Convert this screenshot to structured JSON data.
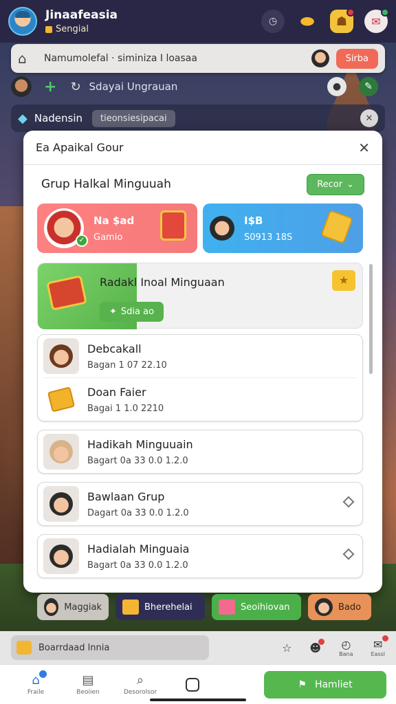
{
  "header": {
    "name": "Jinaafeasia",
    "subtitle": "Sengial"
  },
  "search": {
    "text": "Namumolefal · siminiza I loasaa",
    "button": "Sirba"
  },
  "second_row": {
    "text": "Sdayai Ungrauan"
  },
  "third_row": {
    "label": "Nadensin",
    "pill": "tieonsiesipacai"
  },
  "modal": {
    "title": "Ea Apaikal Gour",
    "section_title": "Grup Halkal Minguuah",
    "filter_button": "Recor",
    "promo_cards": [
      {
        "title": "Na $ad",
        "subtitle": "Gamio"
      },
      {
        "title": "I$B",
        "subtitle": "S0913 18S"
      }
    ],
    "featured": {
      "title": "Radakl Inoal Minguaan",
      "button": "Sdia ao"
    },
    "list": [
      {
        "title": "Debcakall",
        "subtitle": "Bagan 1 07 22.10"
      },
      {
        "title": "Doan Faier",
        "subtitle": "Bagai 1 1.0 2210"
      },
      {
        "title": "Hadikah Minguuain",
        "subtitle": "Bagart 0a 33 0.0 1.2.0"
      },
      {
        "title": "Bawlaan Grup",
        "subtitle": "Dagart 0a 33 0.0 1.2.0"
      },
      {
        "title": "Hadialah Minguaia",
        "subtitle": "Bagart 0a 33 0.0 1.2.0"
      }
    ]
  },
  "bottom_chips": [
    {
      "label": "Maggiak"
    },
    {
      "label": "Bherehelai"
    },
    {
      "label": "Seoihiovan"
    },
    {
      "label": "Bado"
    }
  ],
  "status_bar": {
    "pill_text": "Boarrdaad lnnia",
    "icon_labels": [
      "",
      "",
      "Bana",
      "Eassl"
    ]
  },
  "bottom_nav": {
    "items": [
      "Fraile",
      "Beoiien",
      "Desorolsor",
      ""
    ],
    "cta": "Hamliet"
  },
  "colors": {
    "accent_green": "#54b84f",
    "header_bg": "#2a2645",
    "sub_button": "#f06a57"
  }
}
